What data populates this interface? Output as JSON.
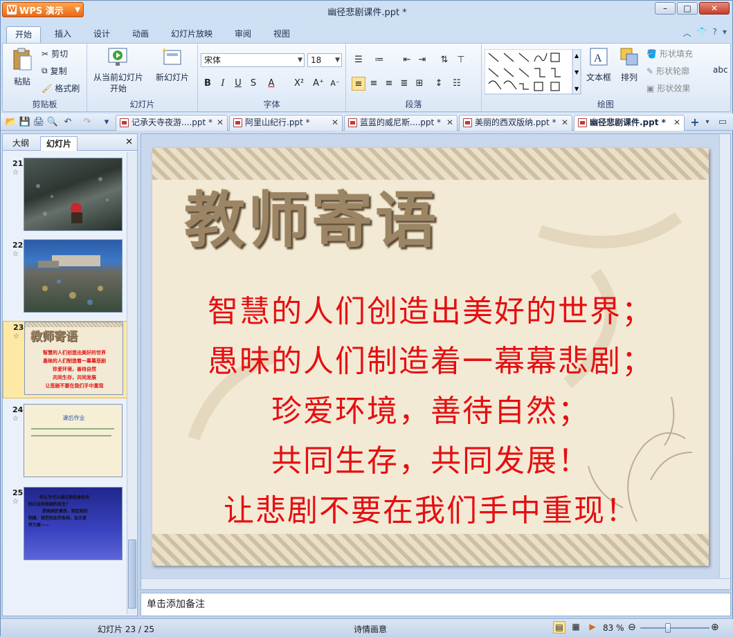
{
  "app": {
    "name": "WPS 演示",
    "doc_title": "幽径悲剧课件.ppt *"
  },
  "menu_tabs": [
    "开始",
    "插入",
    "设计",
    "动画",
    "幻灯片放映",
    "审阅",
    "视图"
  ],
  "ribbon": {
    "clipboard": {
      "paste": "粘贴",
      "cut": "剪切",
      "copy": "复制",
      "format_painter": "格式刷",
      "label": "剪贴板"
    },
    "slides": {
      "from_current": "从当前幻灯片",
      "start": "开始",
      "new_slide": "新幻灯片",
      "label": "幻灯片"
    },
    "font": {
      "name": "宋体",
      "size": "18",
      "label": "字体"
    },
    "paragraph": {
      "label": "段落"
    },
    "drawing": {
      "textbox": "文本框",
      "arrange": "排列",
      "shape_fill": "形状填充",
      "shape_outline": "形状轮廓",
      "shape_effect": "形状效果",
      "label": "绘图"
    }
  },
  "doc_tabs": [
    {
      "label": "记承天寺夜游....ppt *"
    },
    {
      "label": "阿里山纪行.ppt *"
    },
    {
      "label": "蓝蓝的威尼斯....ppt *"
    },
    {
      "label": "美丽的西双版纳.ppt *"
    },
    {
      "label": "幽径悲剧课件.ppt *"
    }
  ],
  "left_pane": {
    "tabs": [
      "大纲",
      "幻灯片"
    ],
    "thumbs": [
      {
        "num": "21"
      },
      {
        "num": "22"
      },
      {
        "num": "23",
        "title": "教师寄语",
        "lines": [
          "智慧的人们创造出美好的世界",
          "愚昧的人们制造着一幕幕悲剧",
          "珍爱环境，善待自然",
          "共同生存，共同发展",
          "让悲剧不要在我们手中重现"
        ]
      },
      {
        "num": "24",
        "title": "课后作业"
      },
      {
        "num": "25",
        "lines": [
          "你认为可以通过那些途径来",
          "制止这种悲剧的发生？",
          "提高国民素质，制定相应",
          "制度、规范和处罚条例，加大宣",
          "传力度——"
        ]
      }
    ]
  },
  "slide": {
    "title": "教师寄语",
    "lines": [
      "智慧的人们创造出美好的世界；",
      "愚昧的人们制造着一幕幕悲剧；",
      "珍爱环境，善待自然；",
      "共同生存，共同发展！",
      "让悲剧不要在我们手中重现！"
    ]
  },
  "notes_placeholder": "单击添加备注",
  "status": {
    "slide_pos": "幻灯片 23 / 25",
    "theme": "诗情画意",
    "zoom": "83 %"
  }
}
